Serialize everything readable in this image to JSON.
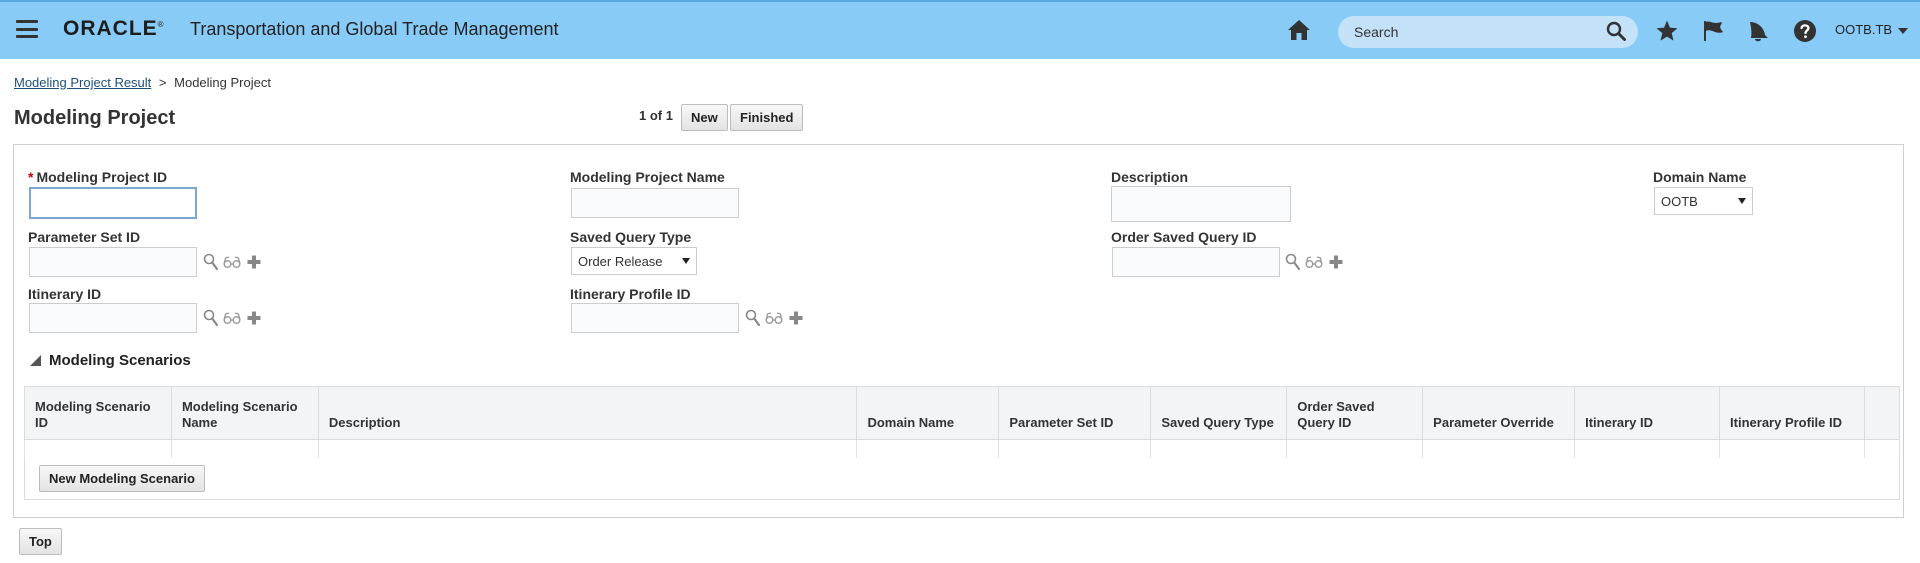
{
  "header": {
    "logo_text": "ORACLE",
    "logo_mark": "®",
    "app_title": "Transportation and Global Trade Management",
    "search_placeholder": "Search",
    "user": "OOTB.TB",
    "bg_color": "#88cbf7",
    "icons": [
      "hamburger-menu-icon",
      "home-icon",
      "search-icon",
      "star-icon",
      "flag-icon",
      "bell-icon",
      "help-icon"
    ]
  },
  "breadcrumb": {
    "parent": "Modeling Project Result",
    "separator": ">",
    "current": "Modeling Project"
  },
  "page": {
    "title": "Modeling Project",
    "pager": "1 of 1",
    "new_label": "New",
    "finished_label": "Finished"
  },
  "form": {
    "modeling_project_id": {
      "label": "Modeling Project ID",
      "required_mark": "*",
      "value": ""
    },
    "modeling_project_name": {
      "label": "Modeling Project Name",
      "value": ""
    },
    "description": {
      "label": "Description",
      "value": ""
    },
    "domain_name": {
      "label": "Domain Name",
      "value": "OOTB"
    },
    "parameter_set_id": {
      "label": "Parameter Set ID",
      "value": ""
    },
    "saved_query_type": {
      "label": "Saved Query Type",
      "value": "Order Release"
    },
    "order_saved_query_id": {
      "label": "Order Saved Query ID",
      "value": ""
    },
    "itinerary_id": {
      "label": "Itinerary ID",
      "value": ""
    },
    "itinerary_profile_id": {
      "label": "Itinerary Profile ID",
      "value": ""
    }
  },
  "scenarios": {
    "section_title": "Modeling Scenarios",
    "columns": [
      "Modeling Scenario ID",
      "Modeling Scenario Name",
      "Description",
      "Domain Name",
      "Parameter Set ID",
      "Saved Query Type",
      "Order Saved Query ID",
      "Parameter Override",
      "Itinerary ID",
      "Itinerary Profile ID",
      ""
    ],
    "new_button_label": "New Modeling Scenario"
  },
  "footer": {
    "top_label": "Top"
  }
}
